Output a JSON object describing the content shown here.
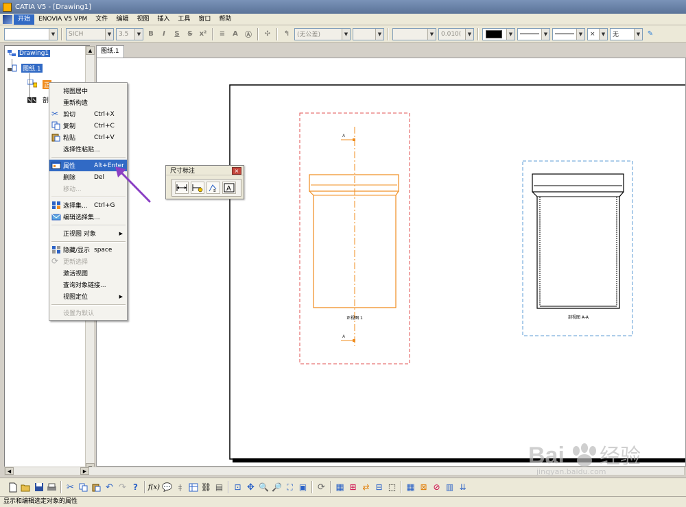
{
  "window": {
    "title": "CATIA V5 - [Drawing1]"
  },
  "menu": {
    "items": [
      "开始",
      "ENOVIA V5 VPM",
      "文件",
      "编辑",
      "视图",
      "插入",
      "工具",
      "窗口",
      "帮助"
    ]
  },
  "properties_bar": {
    "font_name": "SICH",
    "font_size": "3.5",
    "tolerance": "(无公差)",
    "precision": "0.010(",
    "pattern": "无",
    "line_color": "#000000"
  },
  "tree": {
    "root": "Drawing1",
    "sheet": "图纸.1",
    "view_front": "正",
    "view_section": "剖"
  },
  "tabs": [
    {
      "label": "图纸.1"
    }
  ],
  "context_menu": {
    "items": [
      {
        "label": "将图居中",
        "shortcut": ""
      },
      {
        "label": "重新构造",
        "shortcut": ""
      },
      {
        "label": "剪切",
        "shortcut": "Ctrl+X"
      },
      {
        "label": "复制",
        "shortcut": "Ctrl+C"
      },
      {
        "label": "粘贴",
        "shortcut": "Ctrl+V"
      },
      {
        "label": "选择性粘贴...",
        "shortcut": ""
      },
      {
        "label": "属性",
        "shortcut": "Alt+Enter"
      },
      {
        "label": "删除",
        "shortcut": "Del"
      },
      {
        "label": "移动...",
        "shortcut": ""
      },
      {
        "label": "选择集...",
        "shortcut": "Ctrl+G"
      },
      {
        "label": "编辑选择集...",
        "shortcut": ""
      },
      {
        "label": "正视图 对象",
        "shortcut": ""
      },
      {
        "label": "隐藏/显示",
        "shortcut": "space"
      },
      {
        "label": "更新选择",
        "shortcut": ""
      },
      {
        "label": "激活视图",
        "shortcut": ""
      },
      {
        "label": "查询对象链接...",
        "shortcut": ""
      },
      {
        "label": "视图定位",
        "shortcut": ""
      },
      {
        "label": "设置为默认",
        "shortcut": ""
      }
    ]
  },
  "dimension_toolbar": {
    "title": "尺寸标注"
  },
  "drawing": {
    "front_view_label": "正视图 1",
    "section_view_label": "剖视图 A-A",
    "front_view_frame_color": "#e05050",
    "section_view_frame_color": "#5b9bd5",
    "front_view_color": "#f08c1e"
  },
  "status": {
    "text": "显示和编辑选定对象的属性"
  },
  "watermark": {
    "brand": "Bai",
    "brand2": "经验",
    "url": "jingyan.baidu.com"
  },
  "colors": {
    "selection": "#316ac5",
    "arrow": "#8a3fc4"
  }
}
